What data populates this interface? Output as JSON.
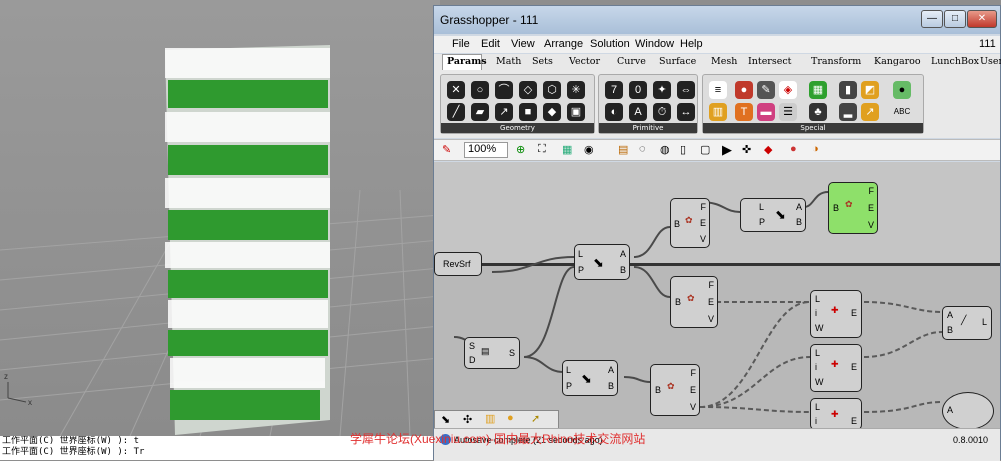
{
  "rhino": {
    "command_lines": [
      "工作平面(C) 世界座标(W) ): t",
      "工作平面(C) 世界座标(W) ): Tr"
    ],
    "axis_labels": {
      "z": "z",
      "x": "x"
    }
  },
  "gh": {
    "title": "Grasshopper - 111",
    "window_buttons": {
      "min": "—",
      "max": "□",
      "close": "✕"
    },
    "menu": [
      "File",
      "Edit",
      "View",
      "Arrange",
      "Solution",
      "Window",
      "Help"
    ],
    "doc_name": "111",
    "tabs": [
      "Params",
      "Math",
      "Sets",
      "Vector",
      "Curve",
      "Surface",
      "Mesh",
      "Intersect",
      "Transform",
      "Kangaroo",
      "LunchBox",
      "User"
    ],
    "panels": [
      "Geometry",
      "Primitive",
      "Special"
    ],
    "zoom": "100%",
    "components": {
      "revsrf": "RevSrf",
      "ports_fev": [
        "F",
        "E",
        "V"
      ],
      "ports_lpab": [
        "L",
        "P",
        "A",
        "B"
      ],
      "ports_sd": [
        "S",
        "D",
        "S"
      ],
      "ports_lie": [
        "L",
        "i",
        "E",
        "W"
      ],
      "ports_abl": [
        "A",
        "B",
        "L"
      ],
      "port_b": "B"
    },
    "status": "Autosave complete (21 seconds ago)",
    "version": "0.8.0010",
    "accent": "#8ee06a"
  },
  "watermark": "学犀牛论坛(Xuexiniu.com)-国内最大Rhino技术交流网站"
}
